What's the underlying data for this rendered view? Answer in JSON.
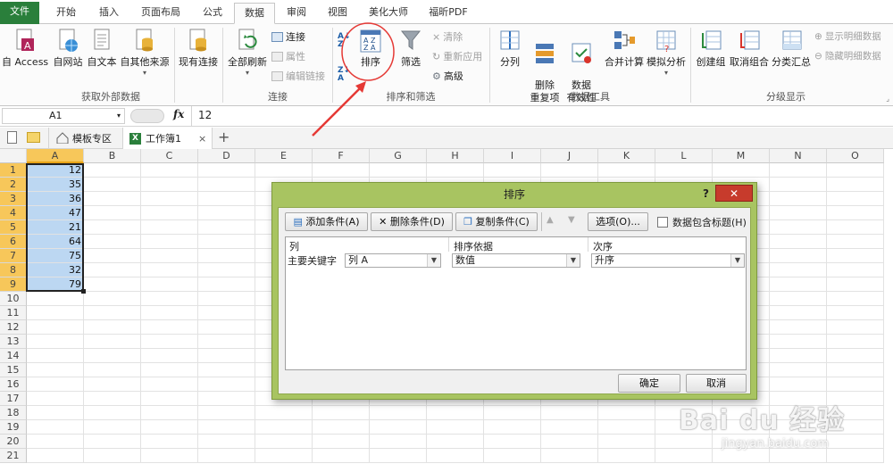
{
  "tabs": [
    "文件",
    "开始",
    "插入",
    "页面布局",
    "公式",
    "数据",
    "审阅",
    "视图",
    "美化大师",
    "福昕PDF"
  ],
  "ribbon": {
    "get_external": [
      "自 Access",
      "自网站",
      "自文本",
      "自其他来源",
      "现有连接"
    ],
    "get_external_group": "获取外部数据",
    "refresh_all": "全部刷新",
    "connections": [
      "连接",
      "属性",
      "编辑链接"
    ],
    "connections_group": "连接",
    "sort": "排序",
    "filter": "筛选",
    "filter_small": [
      "清除",
      "重新应用",
      "高级"
    ],
    "sort_filter_group": "排序和筛选",
    "data_tools": [
      "分列",
      "删除\n重复项",
      "数据\n有效性",
      "合并计算",
      "模拟分析"
    ],
    "data_tools_group": "数据工具",
    "outline": [
      "创建组",
      "取消组合",
      "分类汇总"
    ],
    "outline_small": [
      "显示明细数据",
      "隐藏明细数据"
    ],
    "outline_group": "分级显示"
  },
  "formula_bar": {
    "name_box": "A1",
    "fx": "fx",
    "value": "12"
  },
  "doc_tabs": {
    "template": "模板专区",
    "workbook": "工作簿1"
  },
  "columns": [
    "A",
    "B",
    "C",
    "D",
    "E",
    "F",
    "G",
    "H",
    "I",
    "J",
    "K",
    "L",
    "M",
    "N",
    "O"
  ],
  "rows": [
    "1",
    "2",
    "3",
    "4",
    "5",
    "6",
    "7",
    "8",
    "9",
    "10",
    "11",
    "12",
    "13",
    "14",
    "15",
    "16",
    "17",
    "18",
    "19",
    "20",
    "21"
  ],
  "column_a_values": [
    "12",
    "35",
    "36",
    "47",
    "21",
    "64",
    "75",
    "32",
    "79"
  ],
  "dialog": {
    "title": "排序",
    "help": "?",
    "add_condition": "添加条件(A)",
    "delete_condition": "删除条件(D)",
    "copy_condition": "复制条件(C)",
    "options": "选项(O)...",
    "has_headers": "数据包含标题(H)",
    "headers": {
      "column": "列",
      "sort_on": "排序依据",
      "order": "次序"
    },
    "primary_key_label": "主要关键字",
    "primary_key_value": "列 A",
    "sort_on_value": "数值",
    "order_value": "升序",
    "ok": "确定",
    "cancel": "取消"
  },
  "watermark": {
    "brand": "Bai du 经验",
    "url": "jingyan.baidu.com"
  },
  "colors": {
    "file_tab": "#2a7f3b",
    "dialog_frame": "#a8c461",
    "selection": "#bcd7f2",
    "annotation": "#e53935"
  }
}
